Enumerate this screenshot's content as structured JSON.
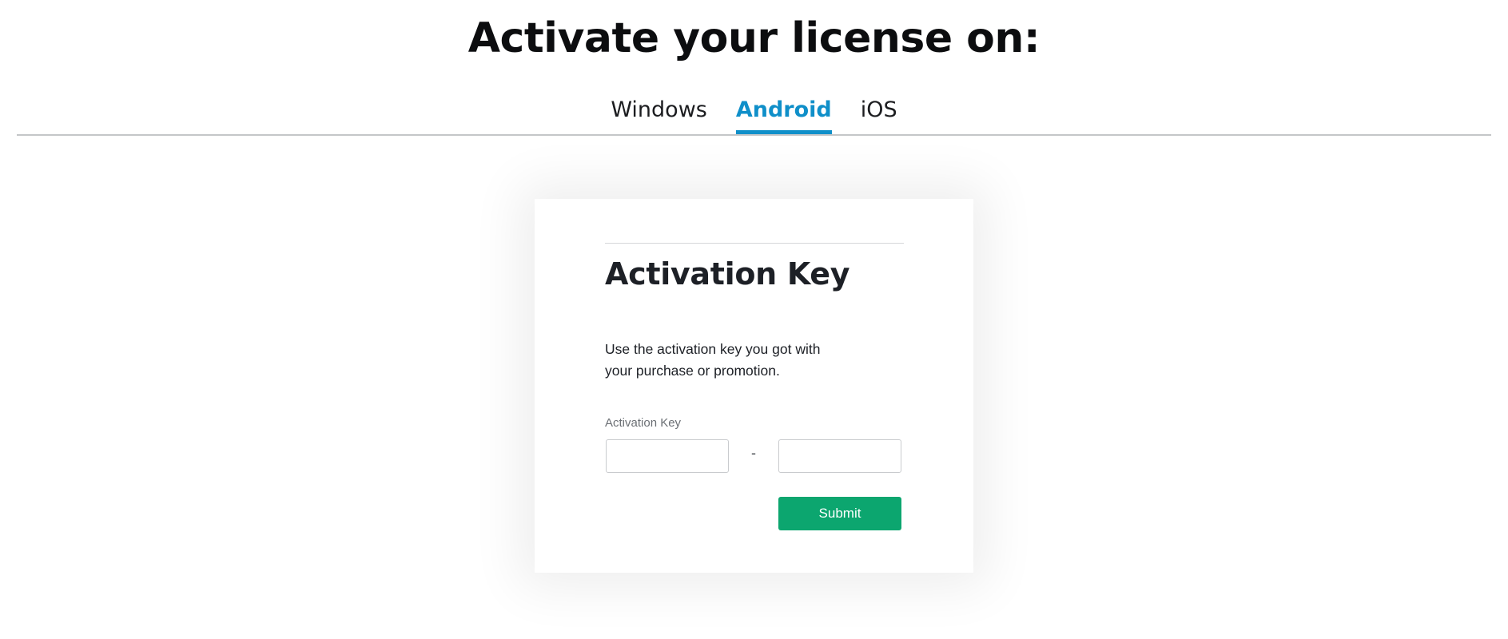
{
  "page": {
    "title": "Activate your license on:"
  },
  "tabs": [
    {
      "label": "Windows",
      "active": false
    },
    {
      "label": "Android",
      "active": true
    },
    {
      "label": "iOS",
      "active": false
    }
  ],
  "card": {
    "heading": "Activation Key",
    "description_line1": "Use the activation key you got with",
    "description_line2": "your purchase or promotion.",
    "field_label": "Activation Key",
    "key_part1_value": "",
    "key_part2_value": "",
    "separator": "-",
    "submit_label": "Submit"
  },
  "colors": {
    "accent": "#0f8fc9",
    "submit": "#0ca66f",
    "text": "#1d2026"
  }
}
